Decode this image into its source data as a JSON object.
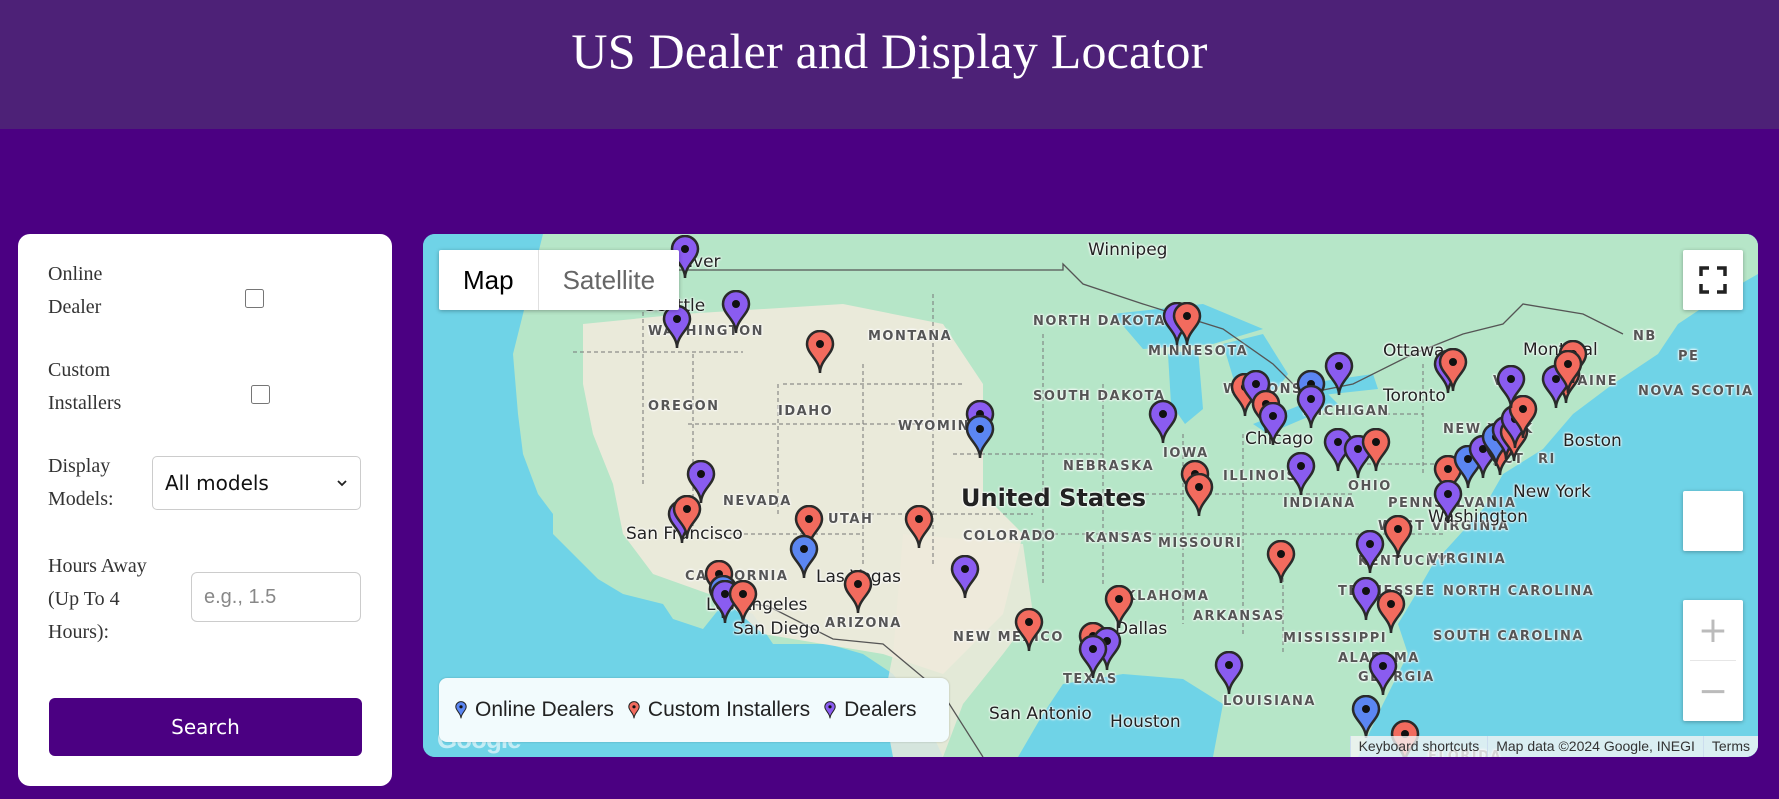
{
  "header": {
    "title": "US Dealer and Display Locator"
  },
  "filters": {
    "online_dealer": {
      "label_line1": "Online",
      "label_line2": "Dealer",
      "checked": false
    },
    "custom_installers": {
      "label_line1": "Custom",
      "label_line2": "Installers",
      "checked": false
    },
    "display_models": {
      "label_line1": "Display",
      "label_line2": "Models:",
      "selected": "All models"
    },
    "hours_away": {
      "label_line1": "Hours Away",
      "label_line2": "(Up To 4",
      "label_line3": "Hours):",
      "value": "",
      "placeholder": "e.g., 1.5"
    },
    "search_label": "Search"
  },
  "map": {
    "map_type_tabs": [
      {
        "label": "Map",
        "active": true
      },
      {
        "label": "Satellite",
        "active": false
      }
    ],
    "country_label": "United States",
    "state_labels": [
      "WASHINGTON",
      "OREGON",
      "IDAHO",
      "MONTANA",
      "WYOMING",
      "NEVADA",
      "UTAH",
      "COLORADO",
      "CALIFORNIA",
      "ARIZONA",
      "NEW MEXICO",
      "NORTH DAKOTA",
      "SOUTH DAKOTA",
      "NEBRASKA",
      "KANSAS",
      "OKLAHOMA",
      "TEXAS",
      "MINNESOTA",
      "IOWA",
      "MISSOURI",
      "ARKANSAS",
      "LOUISIANA",
      "WISCONSIN",
      "ILLINOIS",
      "MICHIGAN",
      "INDIANA",
      "OHIO",
      "KENTUCKY",
      "TENNESSEE",
      "MISSISSIPPI",
      "ALABAMA",
      "GEORGIA",
      "FLORIDA",
      "SOUTH CAROLINA",
      "NORTH CAROLINA",
      "VIRGINIA",
      "WEST VIRGINIA",
      "PENNSYLVANIA",
      "NEW YORK",
      "VT",
      "MAINE",
      "CT",
      "RI",
      "NB",
      "PE",
      "NOVA SCOTIA"
    ],
    "city_labels": [
      "Vancouver",
      "Seattle",
      "Winnipeg",
      "San Francisco",
      "Las Vegas",
      "Los Angeles",
      "San Diego",
      "Dallas",
      "San Antonio",
      "Houston",
      "Chicago",
      "Toronto",
      "Ottawa",
      "Montreal",
      "Boston",
      "New York",
      "Washington"
    ],
    "legend": [
      {
        "label": "Online Dealers",
        "color": "#5b86f2"
      },
      {
        "label": "Custom Installers",
        "color": "#f26b5e"
      },
      {
        "label": "Dealers",
        "color": "#8a5cf0"
      }
    ],
    "attribution": {
      "shortcuts": "Keyboard shortcuts",
      "data": "Map data ©2024 Google, INEGI",
      "terms": "Terms"
    },
    "google_logo": "Google",
    "marker_colors": {
      "online": "#5b86f2",
      "installer": "#f26b5e",
      "dealer": "#8a5cf0"
    },
    "markers": [
      {
        "type": "dealer",
        "near": "Vancouver"
      },
      {
        "type": "dealer",
        "near": "Portland"
      },
      {
        "type": "dealer",
        "near": "Washington east"
      },
      {
        "type": "installer",
        "near": "Idaho"
      },
      {
        "type": "dealer",
        "near": "Minneapolis"
      },
      {
        "type": "installer",
        "near": "Minneapolis"
      },
      {
        "type": "dealer",
        "near": "Denver"
      },
      {
        "type": "online",
        "near": "Denver"
      },
      {
        "type": "installer",
        "near": "Utah"
      },
      {
        "type": "installer",
        "near": "Colorado west"
      },
      {
        "type": "dealer",
        "near": "Colorado south"
      },
      {
        "type": "online",
        "near": "Las Vegas"
      },
      {
        "type": "dealer",
        "near": "San Francisco"
      },
      {
        "type": "installer",
        "near": "San Francisco"
      },
      {
        "type": "dealer",
        "near": "Sacramento"
      },
      {
        "type": "installer",
        "near": "Los Angeles"
      },
      {
        "type": "online",
        "near": "Los Angeles"
      },
      {
        "type": "dealer",
        "near": "Los Angeles"
      },
      {
        "type": "installer",
        "near": "San Diego"
      },
      {
        "type": "installer",
        "near": "Phoenix"
      },
      {
        "type": "installer",
        "near": "New Mexico"
      },
      {
        "type": "installer",
        "near": "Dallas"
      },
      {
        "type": "installer",
        "near": "Austin"
      },
      {
        "type": "dealer",
        "near": "Austin"
      },
      {
        "type": "dealer",
        "near": "San Antonio"
      },
      {
        "type": "dealer",
        "near": "Louisiana"
      },
      {
        "type": "dealer",
        "near": "Iowa"
      },
      {
        "type": "installer",
        "near": "Missouri"
      },
      {
        "type": "installer",
        "near": "St. Louis"
      },
      {
        "type": "installer",
        "near": "Milwaukee"
      },
      {
        "type": "dealer",
        "near": "Milwaukee"
      },
      {
        "type": "installer",
        "near": "Chicago"
      },
      {
        "type": "dealer",
        "near": "Chicago"
      },
      {
        "type": "online",
        "near": "Michigan"
      },
      {
        "type": "dealer",
        "near": "Michigan"
      },
      {
        "type": "dealer",
        "near": "Michigan north"
      },
      {
        "type": "dealer",
        "near": "Indianapolis"
      },
      {
        "type": "dealer",
        "near": "Ohio west"
      },
      {
        "type": "dealer",
        "near": "Ohio"
      },
      {
        "type": "installer",
        "near": "Cleveland"
      },
      {
        "type": "installer",
        "near": "Tennessee"
      },
      {
        "type": "dealer",
        "near": "Virginia west"
      },
      {
        "type": "installer",
        "near": "Virginia"
      },
      {
        "type": "dealer",
        "near": "North Carolina"
      },
      {
        "type": "installer",
        "near": "South Carolina"
      },
      {
        "type": "dealer",
        "near": "Georgia coast"
      },
      {
        "type": "online",
        "near": "Florida"
      },
      {
        "type": "installer",
        "near": "Florida south"
      },
      {
        "type": "dealer",
        "near": "Rochester"
      },
      {
        "type": "installer",
        "near": "Rochester"
      },
      {
        "type": "installer",
        "near": "Washington DC"
      },
      {
        "type": "dealer",
        "near": "Washington DC"
      },
      {
        "type": "online",
        "near": "Baltimore"
      },
      {
        "type": "dealer",
        "near": "Philadelphia"
      },
      {
        "type": "installer",
        "near": "Philadelphia"
      },
      {
        "type": "online",
        "near": "New Jersey"
      },
      {
        "type": "dealer",
        "near": "New Jersey"
      },
      {
        "type": "installer",
        "near": "New York"
      },
      {
        "type": "dealer",
        "near": "New York"
      },
      {
        "type": "installer",
        "near": "Hudson"
      },
      {
        "type": "dealer",
        "near": "Vermont"
      },
      {
        "type": "installer",
        "near": "Massachusetts"
      },
      {
        "type": "dealer",
        "near": "Massachusetts"
      },
      {
        "type": "installer",
        "near": "Maine"
      },
      {
        "type": "installer",
        "near": "New Hampshire"
      }
    ]
  }
}
